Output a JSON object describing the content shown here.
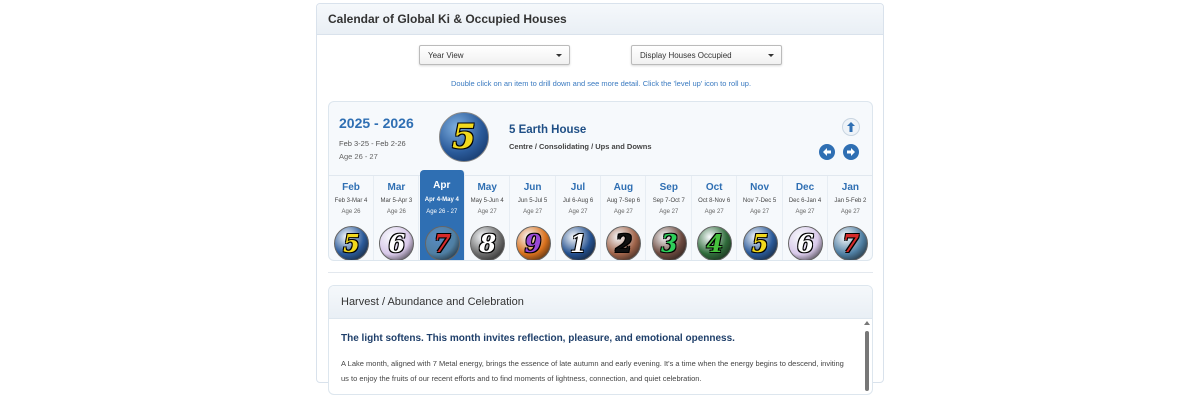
{
  "panel": {
    "title": "Calendar of Global Ki & Occupied Houses"
  },
  "controls": {
    "view_select": "Year View",
    "display_select": "Display Houses Occupied",
    "hint": "Double click on an item to drill down and see more detail. Click the 'level up' icon to roll up."
  },
  "year": {
    "title": "2025 - 2026",
    "dates": "Feb 3-25 - Feb 2-26",
    "age": "Age 26 - 27",
    "house_number": "5",
    "house_title": "5 Earth House",
    "house_subtitle": "Centre / Consolidating / Ups and Downs"
  },
  "icons": {
    "level_up": "level-up-icon",
    "prev": "arrow-left-icon",
    "next": "arrow-right-icon"
  },
  "months": [
    {
      "name": "Feb",
      "range": "Feb 3-Mar 4",
      "age": "Age 26",
      "number": "5",
      "digit_color": "#f2d91d",
      "orb_color": "#2a5a9a",
      "selected": false
    },
    {
      "name": "Mar",
      "range": "Mar 5-Apr 3",
      "age": "Age 26",
      "number": "6",
      "digit_color": "#ffffff",
      "orb_color": "#d9c9ea",
      "selected": false
    },
    {
      "name": "Apr",
      "range": "Apr 4-May 4",
      "age": "Age 26 - 27",
      "number": "7",
      "digit_color": "#d62a2a",
      "orb_color": "#4f7fa3",
      "selected": true
    },
    {
      "name": "May",
      "range": "May 5-Jun 4",
      "age": "Age 27",
      "number": "8",
      "digit_color": "#ffffff",
      "orb_color": "#6d6d6d",
      "selected": false
    },
    {
      "name": "Jun",
      "range": "Jun 5-Jul 5",
      "age": "Age 27",
      "number": "9",
      "digit_color": "#9a4ad6",
      "orb_color": "#d9711d",
      "selected": false
    },
    {
      "name": "Jul",
      "range": "Jul 6-Aug 6",
      "age": "Age 27",
      "number": "1",
      "digit_color": "#ffffff",
      "orb_color": "#23508f",
      "selected": false
    },
    {
      "name": "Aug",
      "range": "Aug 7-Sep 6",
      "age": "Age 27",
      "number": "2",
      "digit_color": "#111111",
      "orb_color": "#a0644a",
      "selected": false
    },
    {
      "name": "Sep",
      "range": "Sep 7-Oct 7",
      "age": "Age 27",
      "number": "3",
      "digit_color": "#2ecf5a",
      "orb_color": "#6d4a3f",
      "selected": false
    },
    {
      "name": "Oct",
      "range": "Oct 8-Nov 6",
      "age": "Age 27",
      "number": "4",
      "digit_color": "#46c23d",
      "orb_color": "#2f6b3a",
      "selected": false
    },
    {
      "name": "Nov",
      "range": "Nov 7-Dec 5",
      "age": "Age 27",
      "number": "5",
      "digit_color": "#f2d91d",
      "orb_color": "#2a5a9a",
      "selected": false
    },
    {
      "name": "Dec",
      "range": "Dec 6-Jan 4",
      "age": "Age 27",
      "number": "6",
      "digit_color": "#ffffff",
      "orb_color": "#d9c9ea",
      "selected": false
    },
    {
      "name": "Jan",
      "range": "Jan 5-Feb 2",
      "age": "Age 27",
      "number": "7",
      "digit_color": "#d62a2a",
      "orb_color": "#4f7fa3",
      "selected": false
    }
  ],
  "detail": {
    "title": "Harvest / Abundance and Celebration",
    "subtitle": "The light softens. This month invites reflection, pleasure, and emotional openness.",
    "body": "A Lake month, aligned with 7 Metal energy, brings the essence of late autumn and early evening. It's a time when the energy begins to descend, inviting us to enjoy the fruits of our recent efforts and to find moments of lightness, connection, and quiet celebration."
  },
  "colors": {
    "accent": "#2f6fb3",
    "title_dark": "#1f4f86"
  }
}
